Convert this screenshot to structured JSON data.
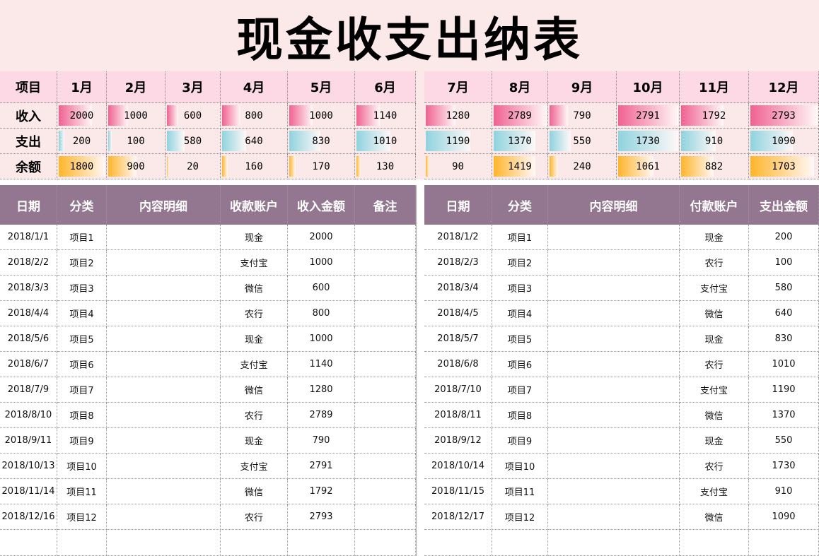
{
  "title": "现金收支出纳表",
  "summary": {
    "header_label": "项目",
    "months": [
      "1月",
      "2月",
      "3月",
      "4月",
      "5月",
      "6月",
      "7月",
      "8月",
      "9月",
      "10月",
      "11月",
      "12月"
    ],
    "row_labels": [
      "收入",
      "支出",
      "余额"
    ],
    "income": [
      2000,
      1000,
      600,
      800,
      1000,
      1140,
      1280,
      2789,
      790,
      2791,
      1792,
      2793
    ],
    "expense": [
      200,
      100,
      580,
      640,
      830,
      1010,
      1190,
      1370,
      550,
      1730,
      910,
      1090
    ],
    "balance": [
      1800,
      900,
      20,
      160,
      170,
      130,
      90,
      1419,
      240,
      1061,
      882,
      1703
    ]
  },
  "colors": {
    "income_bar": "#f06292",
    "expense_bar": "#8fd3de",
    "balance_bar": "#ffb52b",
    "header_bg": "#93768f",
    "summary_bg": "#fbe8e8",
    "summary_header_bg": "#fcd9e5"
  },
  "income_table": {
    "headers": [
      "日期",
      "分类",
      "内容明细",
      "收款账户",
      "收入金额",
      "备注"
    ],
    "rows": [
      [
        "2018/1/1",
        "项目1",
        "",
        "现金",
        "2000",
        ""
      ],
      [
        "2018/2/2",
        "项目2",
        "",
        "支付宝",
        "1000",
        ""
      ],
      [
        "2018/3/3",
        "项目3",
        "",
        "微信",
        "600",
        ""
      ],
      [
        "2018/4/4",
        "项目4",
        "",
        "农行",
        "800",
        ""
      ],
      [
        "2018/5/6",
        "项目5",
        "",
        "现金",
        "1000",
        ""
      ],
      [
        "2018/6/7",
        "项目6",
        "",
        "支付宝",
        "1140",
        ""
      ],
      [
        "2018/7/9",
        "项目7",
        "",
        "微信",
        "1280",
        ""
      ],
      [
        "2018/8/10",
        "项目8",
        "",
        "农行",
        "2789",
        ""
      ],
      [
        "2018/9/11",
        "项目9",
        "",
        "现金",
        "790",
        ""
      ],
      [
        "2018/10/13",
        "项目10",
        "",
        "支付宝",
        "2791",
        ""
      ],
      [
        "2018/11/14",
        "项目11",
        "",
        "微信",
        "1792",
        ""
      ],
      [
        "2018/12/16",
        "项目12",
        "",
        "农行",
        "2793",
        ""
      ],
      [
        "",
        "",
        "",
        "",
        "",
        ""
      ]
    ]
  },
  "expense_table": {
    "headers": [
      "日期",
      "分类",
      "内容明细",
      "付款账户",
      "支出金额"
    ],
    "rows": [
      [
        "2018/1/2",
        "项目1",
        "",
        "现金",
        "200"
      ],
      [
        "2018/2/3",
        "项目2",
        "",
        "农行",
        "100"
      ],
      [
        "2018/3/4",
        "项目3",
        "",
        "支付宝",
        "580"
      ],
      [
        "2018/4/5",
        "项目4",
        "",
        "微信",
        "640"
      ],
      [
        "2018/5/7",
        "项目5",
        "",
        "现金",
        "830"
      ],
      [
        "2018/6/8",
        "项目6",
        "",
        "农行",
        "1010"
      ],
      [
        "2018/7/10",
        "项目7",
        "",
        "支付宝",
        "1190"
      ],
      [
        "2018/8/11",
        "项目8",
        "",
        "微信",
        "1370"
      ],
      [
        "2018/9/12",
        "项目9",
        "",
        "现金",
        "550"
      ],
      [
        "2018/10/14",
        "项目10",
        "",
        "农行",
        "1730"
      ],
      [
        "2018/11/15",
        "项目11",
        "",
        "支付宝",
        "910"
      ],
      [
        "2018/12/17",
        "项目12",
        "",
        "微信",
        "1090"
      ],
      [
        "",
        "",
        "",
        "",
        ""
      ]
    ]
  }
}
